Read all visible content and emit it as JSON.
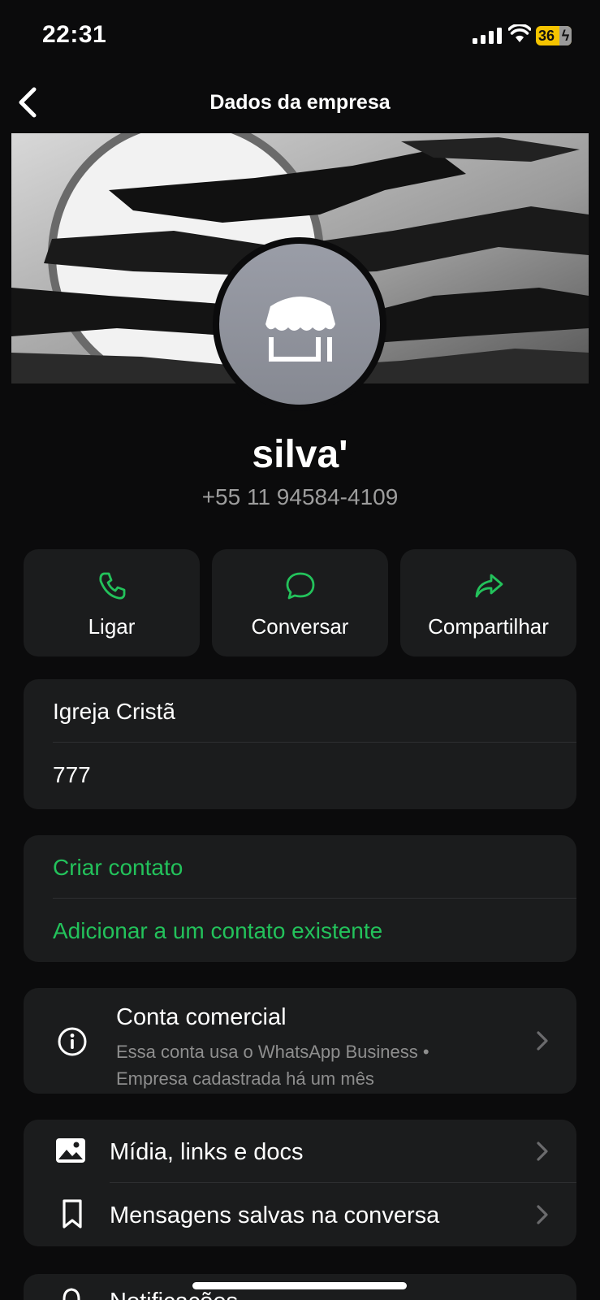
{
  "status": {
    "time": "22:31",
    "battery": "36"
  },
  "nav": {
    "title": "Dados da empresa"
  },
  "profile": {
    "name": "silva'",
    "phone": "+55 11 94584-4109"
  },
  "actions": [
    {
      "label": "Ligar",
      "icon": "phone-icon"
    },
    {
      "label": "Conversar",
      "icon": "chat-bubble-icon"
    },
    {
      "label": "Compartilhar",
      "icon": "share-arrow-icon"
    }
  ],
  "about": [
    "Igreja Cristã",
    "777"
  ],
  "contact_actions": [
    "Criar contato",
    "Adicionar a um contato existente"
  ],
  "business": {
    "title": "Conta comercial",
    "subtitle_line1": "Essa conta usa o WhatsApp Business •",
    "subtitle_line2": "Empresa cadastrada há um mês"
  },
  "media": [
    {
      "label": "Mídia, links e docs",
      "icon": "image-icon"
    },
    {
      "label": "Mensagens salvas na conversa",
      "icon": "bookmark-icon"
    }
  ],
  "partial": {
    "label": "Notificações"
  },
  "colors": {
    "accent": "#23c25b",
    "card": "#1b1c1d",
    "background": "#0b0b0c"
  }
}
